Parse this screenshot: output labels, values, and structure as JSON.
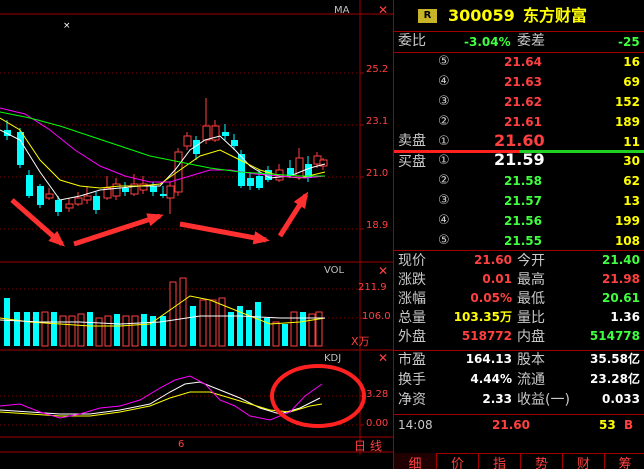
{
  "chart": {
    "ma_label": "MA",
    "vol_label": "VOL",
    "kdj_label": "KDJ",
    "price_ticks": [
      "25.2",
      "23.1",
      "21.0",
      "18.9"
    ],
    "vol_ticks": [
      "211.9",
      "106.0"
    ],
    "vol_unit": "X万",
    "kdj_ticks": [
      "3.28",
      "0.00"
    ],
    "bottom_label": "6",
    "period_label": "日线"
  },
  "quote": {
    "badge": "R",
    "code": "300059",
    "name": "东方财富",
    "weibi_label": "委比",
    "weibi_value": "-3.04%",
    "weicha_label": "委差",
    "weicha_value": "-25",
    "sell_label": "卖盘",
    "buy_label": "买盘",
    "sell_levels": [
      {
        "idx": "⑤",
        "price": "21.64",
        "vol": "16"
      },
      {
        "idx": "④",
        "price": "21.63",
        "vol": "69"
      },
      {
        "idx": "③",
        "price": "21.62",
        "vol": "152"
      },
      {
        "idx": "②",
        "price": "21.61",
        "vol": "189"
      },
      {
        "idx": "①",
        "price": "21.60",
        "vol": "11"
      }
    ],
    "buy_levels": [
      {
        "idx": "①",
        "price": "21.59",
        "vol": "30"
      },
      {
        "idx": "②",
        "price": "21.58",
        "vol": "62"
      },
      {
        "idx": "③",
        "price": "21.57",
        "vol": "13"
      },
      {
        "idx": "④",
        "price": "21.56",
        "vol": "199"
      },
      {
        "idx": "⑤",
        "price": "21.55",
        "vol": "108"
      }
    ],
    "stats": [
      {
        "l1": "现价",
        "v1": "21.60",
        "c1": "red",
        "l2": "今开",
        "v2": "21.40",
        "c2": "green"
      },
      {
        "l1": "涨跌",
        "v1": "0.01",
        "c1": "red",
        "l2": "最高",
        "v2": "21.98",
        "c2": "red"
      },
      {
        "l1": "涨幅",
        "v1": "0.05%",
        "c1": "red",
        "l2": "最低",
        "v2": "20.61",
        "c2": "green"
      },
      {
        "l1": "总量",
        "v1": "103.35万",
        "c1": "yellow",
        "l2": "量比",
        "v2": "1.36",
        "c2": "white"
      },
      {
        "l1": "外盘",
        "v1": "518772",
        "c1": "red",
        "l2": "内盘",
        "v2": "514778",
        "c2": "green"
      }
    ],
    "fundamentals": [
      {
        "l1": "市盈",
        "v1": "164.13",
        "l2": "股本",
        "v2": "35.58亿"
      },
      {
        "l1": "换手",
        "v1": "4.44%",
        "l2": "流通",
        "v2": "23.28亿"
      },
      {
        "l1": "净资",
        "v1": "2.33",
        "l2": "收益(一)",
        "v2": "0.033"
      }
    ],
    "tick": {
      "time": "14:08",
      "price": "21.60",
      "vol": "53",
      "dir": "B"
    },
    "tabs": [
      "细",
      "价",
      "指",
      "势",
      "财",
      "筹"
    ]
  },
  "colors": {
    "up": "#ff4040",
    "down": "#00ffff",
    "grid": "#a00000",
    "ma5": "#ffffff",
    "ma10": "#ffff00",
    "ma20": "#ff00ff",
    "ma30": "#00ff00"
  }
}
